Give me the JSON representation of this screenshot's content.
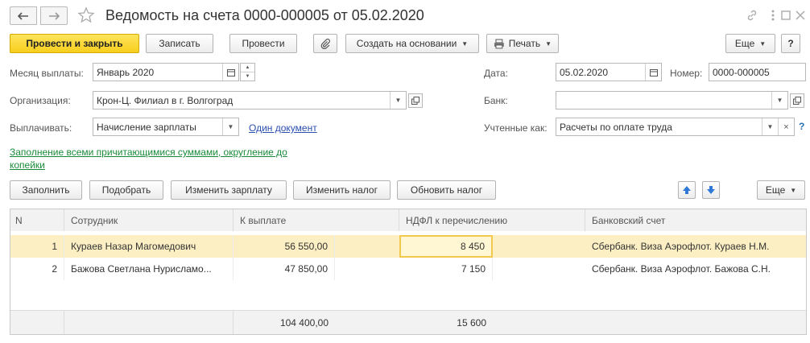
{
  "window": {
    "title": "Ведомость на счета 0000-000005 от 05.02.2020",
    "link_icon": "link-icon",
    "more_icon": "more-vertical-icon",
    "maximize_icon": "maximize-icon",
    "close_icon": "close-icon"
  },
  "toolbar": {
    "post_and_close": "Провести и закрыть",
    "save": "Записать",
    "post": "Провести",
    "create_based_on": "Создать на основании",
    "print": "Печать",
    "more": "Еще"
  },
  "form": {
    "month_label": "Месяц выплаты:",
    "month_value": "Январь 2020",
    "org_label": "Организация:",
    "org_value": "Крон-Ц. Филиал в г. Волгоград",
    "pay_label": "Выплачивать:",
    "pay_value": "Начисление зарплаты",
    "one_document_link": "Один документ",
    "date_label": "Дата:",
    "date_value": "05.02.2020",
    "number_label": "Номер:",
    "number_value": "0000-000005",
    "bank_label": "Банк:",
    "bank_value": "",
    "accounted_label": "Учтенные как:",
    "accounted_value": "Расчеты по оплате труда",
    "help_mark": "?"
  },
  "fill_hint": "Заполнение всеми причитающимися суммами, округление до копейки",
  "table_toolbar": {
    "fill": "Заполнить",
    "pick": "Подобрать",
    "change_salary": "Изменить зарплату",
    "change_tax": "Изменить налог",
    "update_tax": "Обновить налог",
    "more": "Еще"
  },
  "table": {
    "columns": [
      "N",
      "Сотрудник",
      "К выплате",
      "НДФЛ к перечислению",
      "Банковский счет"
    ],
    "rows": [
      {
        "n": "1",
        "employee": "Кураев Назар Магомедович",
        "amount": "56 550,00",
        "tax": "8 450",
        "account": "Сбербанк. Виза Аэрофлот. Кураев Н.М."
      },
      {
        "n": "2",
        "employee": "Бажова Светлана Нурисламо...",
        "amount": "47 850,00",
        "tax": "7 150",
        "account": "Сбербанк. Виза Аэрофлот. Бажова С.Н."
      }
    ],
    "totals": {
      "amount": "104 400,00",
      "tax": "15 600"
    }
  }
}
